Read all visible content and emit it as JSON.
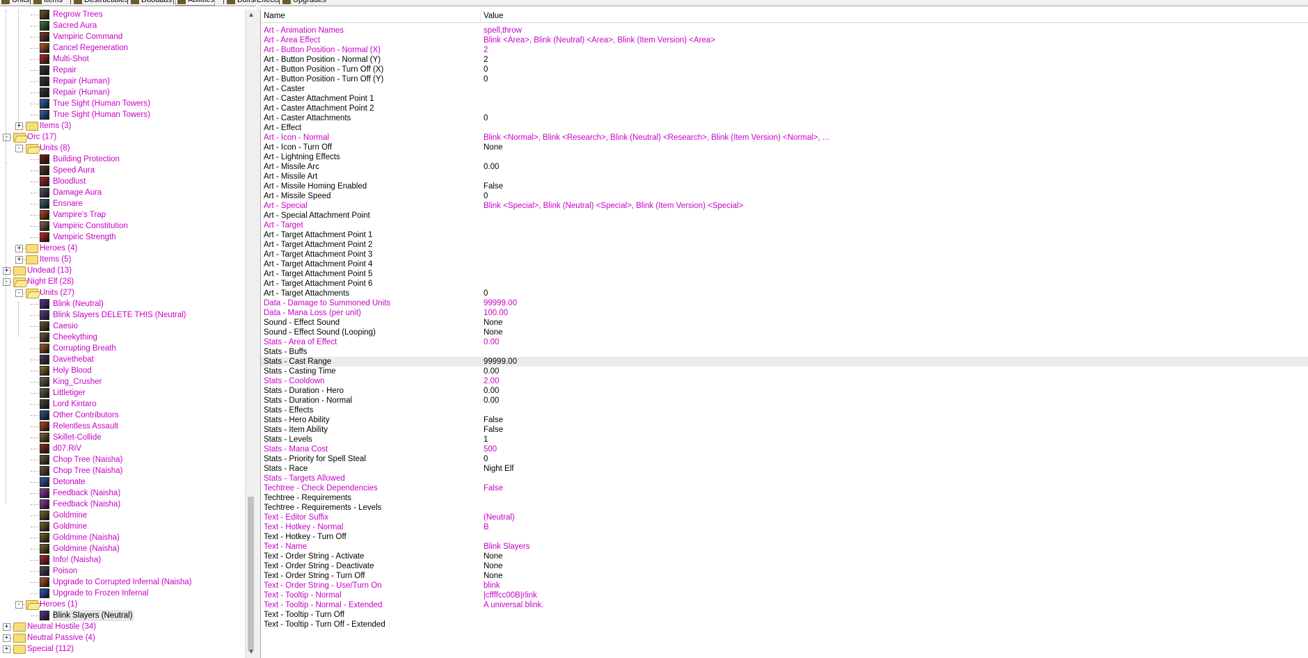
{
  "tabs": [
    {
      "label": "Units",
      "icon": "unit-icon"
    },
    {
      "label": "Items",
      "icon": "item-icon"
    },
    {
      "label": "Destructibles",
      "icon": "destructible-icon"
    },
    {
      "label": "Doodads",
      "icon": "doodad-icon"
    },
    {
      "label": "Abilities",
      "icon": "ability-icon",
      "active": true
    },
    {
      "label": "Buffs/Effects",
      "icon": "buff-icon"
    },
    {
      "label": "Upgrades",
      "icon": "upgrade-icon"
    }
  ],
  "tree": [
    {
      "label": "Regrow Trees",
      "level": 3,
      "kind": "ability",
      "color": "#7a5a2a"
    },
    {
      "label": "Sacred Aura",
      "level": 3,
      "kind": "ability",
      "color": "#4a7a3a"
    },
    {
      "label": "Vampiric Command",
      "level": 3,
      "kind": "ability",
      "color": "#8a3a2a"
    },
    {
      "label": "Cancel Regeneration",
      "level": 3,
      "kind": "ability",
      "color": "#c85a20"
    },
    {
      "label": "Multi-Shot",
      "level": 3,
      "kind": "ability",
      "color": "#c02a2a"
    },
    {
      "label": "Repair",
      "level": 3,
      "kind": "ability",
      "color": "#3a3a3a"
    },
    {
      "label": "Repair (Human)",
      "level": 3,
      "kind": "ability",
      "color": "#3a3a3a"
    },
    {
      "label": "Repair (Human)",
      "level": 3,
      "kind": "ability",
      "color": "#3a3a3a"
    },
    {
      "label": "True Sight (Human Towers)",
      "level": 3,
      "kind": "ability",
      "color": "#2a6ac0"
    },
    {
      "label": "True Sight (Human Towers)",
      "level": 3,
      "kind": "ability",
      "color": "#2a6ac0"
    },
    {
      "label": "Items (3)",
      "level": 2,
      "kind": "folder",
      "exp": "+"
    },
    {
      "label": "Orc (17)",
      "level": 1,
      "kind": "folder",
      "exp": "-",
      "open": true
    },
    {
      "label": "Units (8)",
      "level": 2,
      "kind": "folder",
      "exp": "-",
      "open": true
    },
    {
      "label": "Building Protection",
      "level": 3,
      "kind": "ability",
      "color": "#8a1a1a"
    },
    {
      "label": "Speed Aura",
      "level": 3,
      "kind": "ability",
      "color": "#5a3a2a"
    },
    {
      "label": "Bloodlust",
      "level": 3,
      "kind": "ability",
      "color": "#b02a1a"
    },
    {
      "label": "Damage Aura",
      "level": 3,
      "kind": "ability",
      "color": "#5a5a6a"
    },
    {
      "label": "Ensnare",
      "level": 3,
      "kind": "ability",
      "color": "#3a6a7a"
    },
    {
      "label": "Vampire's Trap",
      "level": 3,
      "kind": "ability",
      "color": "#c84a1a"
    },
    {
      "label": "Vampiric Constitution",
      "level": 3,
      "kind": "ability",
      "color": "#8a6a4a"
    },
    {
      "label": "Vampiric Strength",
      "level": 3,
      "kind": "ability",
      "color": "#d02a1a"
    },
    {
      "label": "Heroes (4)",
      "level": 2,
      "kind": "folder",
      "exp": "+"
    },
    {
      "label": "Items (5)",
      "level": 2,
      "kind": "folder",
      "exp": "+"
    },
    {
      "label": "Undead (13)",
      "level": 1,
      "kind": "folder",
      "exp": "+"
    },
    {
      "label": "Night Elf (28)",
      "level": 1,
      "kind": "folder",
      "exp": "-",
      "open": true
    },
    {
      "label": "Units (27)",
      "level": 2,
      "kind": "folder",
      "exp": "-",
      "open": true
    },
    {
      "label": "Blink (Neutral)",
      "level": 3,
      "kind": "ability",
      "color": "#5a3aa0"
    },
    {
      "label": "Blink Slayers DELETE THIS (Neutral)",
      "level": 3,
      "kind": "ability",
      "color": "#5a3aa0"
    },
    {
      "label": "Caesio",
      "level": 3,
      "kind": "ability",
      "color": "#6a5a2a"
    },
    {
      "label": "Cheekything",
      "level": 3,
      "kind": "ability",
      "color": "#7a5a3a"
    },
    {
      "label": "Corrupting Breath",
      "level": 3,
      "kind": "ability",
      "color": "#b05a2a"
    },
    {
      "label": "Davethebat",
      "level": 3,
      "kind": "ability",
      "color": "#4a3a6a"
    },
    {
      "label": "Holy Blood",
      "level": 3,
      "kind": "ability",
      "color": "#8a7a2a"
    },
    {
      "label": "King_Crusher",
      "level": 3,
      "kind": "ability",
      "color": "#6a6a5a"
    },
    {
      "label": "Littletiger",
      "level": 3,
      "kind": "ability",
      "color": "#5a6a4a"
    },
    {
      "label": "Lord Kintaro",
      "level": 3,
      "kind": "ability",
      "color": "#4a4a3a"
    },
    {
      "label": "Other Contributors",
      "level": 3,
      "kind": "ability",
      "color": "#2a5a8a"
    },
    {
      "label": "Relentless Assault",
      "level": 3,
      "kind": "ability",
      "color": "#c04a1a"
    },
    {
      "label": "Skillet-Collide",
      "level": 3,
      "kind": "ability",
      "color": "#8a6a2a"
    },
    {
      "label": "d07.RiV",
      "level": 3,
      "kind": "ability",
      "color": "#9a2a1a"
    },
    {
      "label": "Chop Tree (Naisha)",
      "level": 3,
      "kind": "ability",
      "color": "#6a5a3a"
    },
    {
      "label": "Chop Tree (Naisha)",
      "level": 3,
      "kind": "ability",
      "color": "#6a5a3a"
    },
    {
      "label": "Detonate",
      "level": 3,
      "kind": "ability",
      "color": "#3a5ac0"
    },
    {
      "label": "Feedback (Naisha)",
      "level": 3,
      "kind": "ability",
      "color": "#a03ab0"
    },
    {
      "label": "Feedback (Naisha)",
      "level": 3,
      "kind": "ability",
      "color": "#a03ab0"
    },
    {
      "label": "Goldmine",
      "level": 3,
      "kind": "ability",
      "color": "#7a6a2a"
    },
    {
      "label": "Goldmine",
      "level": 3,
      "kind": "ability",
      "color": "#7a6a2a"
    },
    {
      "label": "Goldmine (Naisha)",
      "level": 3,
      "kind": "ability",
      "color": "#7a6a2a"
    },
    {
      "label": "Goldmine (Naisha)",
      "level": 3,
      "kind": "ability",
      "color": "#7a6a2a"
    },
    {
      "label": "Info! (Naisha)",
      "level": 3,
      "kind": "ability",
      "color": "#c02a2a"
    },
    {
      "label": "Poison",
      "level": 3,
      "kind": "ability",
      "color": "#5a4a5a"
    },
    {
      "label": "Upgrade to Corrupted Infernal (Naisha)",
      "level": 3,
      "kind": "ability",
      "color": "#c05a1a"
    },
    {
      "label": "Upgrade to Frozen Infernal",
      "level": 3,
      "kind": "ability",
      "color": "#2a5ad0"
    },
    {
      "label": "Heroes (1)",
      "level": 2,
      "kind": "folder",
      "exp": "-",
      "open": true
    },
    {
      "label": "Blink Slayers (Neutral)",
      "level": 3,
      "kind": "ability",
      "color": "#5a3aa0",
      "selected": true
    },
    {
      "label": "Neutral Hostile (34)",
      "level": 1,
      "kind": "folder",
      "exp": "+"
    },
    {
      "label": "Neutral Passive (4)",
      "level": 1,
      "kind": "folder",
      "exp": "+"
    },
    {
      "label": "Special (112)",
      "level": 1,
      "kind": "folder",
      "exp": "+"
    }
  ],
  "grid": {
    "header": {
      "name": "Name",
      "value": "Value"
    },
    "rows": [
      {
        "name": "Art - Animation Names",
        "value": "spell,throw",
        "mod": true
      },
      {
        "name": "Art - Area Effect",
        "value": "Blink <Area>, Blink (Neutral) <Area>, Blink (Item Version) <Area>",
        "mod": true
      },
      {
        "name": "Art - Button Position - Normal (X)",
        "value": "2",
        "mod": true
      },
      {
        "name": "Art - Button Position - Normal (Y)",
        "value": "2"
      },
      {
        "name": "Art - Button Position - Turn Off (X)",
        "value": "0"
      },
      {
        "name": "Art - Button Position - Turn Off (Y)",
        "value": "0"
      },
      {
        "name": "Art - Caster",
        "value": ""
      },
      {
        "name": "Art - Caster Attachment Point 1",
        "value": ""
      },
      {
        "name": "Art - Caster Attachment Point 2",
        "value": ""
      },
      {
        "name": "Art - Caster Attachments",
        "value": "0"
      },
      {
        "name": "Art - Effect",
        "value": ""
      },
      {
        "name": "Art - Icon - Normal",
        "value": "Blink <Normal>, Blink <Research>, Blink (Neutral) <Research>, Blink (Item Version) <Normal>, ...",
        "mod": true
      },
      {
        "name": "Art - Icon - Turn Off",
        "value": "None"
      },
      {
        "name": "Art - Lightning Effects",
        "value": ""
      },
      {
        "name": "Art - Missile Arc",
        "value": "0.00"
      },
      {
        "name": "Art - Missile Art",
        "value": ""
      },
      {
        "name": "Art - Missile Homing Enabled",
        "value": "False"
      },
      {
        "name": "Art - Missile Speed",
        "value": "0"
      },
      {
        "name": "Art - Special",
        "value": "Blink <Special>, Blink (Neutral) <Special>, Blink (Item Version) <Special>",
        "mod": true
      },
      {
        "name": "Art - Special Attachment Point",
        "value": ""
      },
      {
        "name": "Art - Target",
        "value": "",
        "mod": true
      },
      {
        "name": "Art - Target Attachment Point 1",
        "value": ""
      },
      {
        "name": "Art - Target Attachment Point 2",
        "value": ""
      },
      {
        "name": "Art - Target Attachment Point 3",
        "value": ""
      },
      {
        "name": "Art - Target Attachment Point 4",
        "value": ""
      },
      {
        "name": "Art - Target Attachment Point 5",
        "value": ""
      },
      {
        "name": "Art - Target Attachment Point 6",
        "value": ""
      },
      {
        "name": "Art - Target Attachments",
        "value": "0"
      },
      {
        "name": "Data - Damage to Summoned Units",
        "value": "99999.00",
        "mod": true
      },
      {
        "name": "Data - Mana Loss (per unit)",
        "value": "100.00",
        "mod": true
      },
      {
        "name": "Sound - Effect Sound",
        "value": "None"
      },
      {
        "name": "Sound - Effect Sound (Looping)",
        "value": "None"
      },
      {
        "name": "Stats - Area of Effect",
        "value": "0.00",
        "mod": true
      },
      {
        "name": "Stats - Buffs",
        "value": ""
      },
      {
        "name": "Stats - Cast Range",
        "value": "99999.00",
        "highlight": true
      },
      {
        "name": "Stats - Casting Time",
        "value": "0.00"
      },
      {
        "name": "Stats - Cooldown",
        "value": "2.00",
        "mod": true
      },
      {
        "name": "Stats - Duration - Hero",
        "value": "0.00"
      },
      {
        "name": "Stats - Duration - Normal",
        "value": "0.00"
      },
      {
        "name": "Stats - Effects",
        "value": ""
      },
      {
        "name": "Stats - Hero Ability",
        "value": "False"
      },
      {
        "name": "Stats - Item Ability",
        "value": "False"
      },
      {
        "name": "Stats - Levels",
        "value": "1"
      },
      {
        "name": "Stats - Mana Cost",
        "value": "500",
        "mod": true
      },
      {
        "name": "Stats - Priority for Spell Steal",
        "value": "0"
      },
      {
        "name": "Stats - Race",
        "value": "Night Elf"
      },
      {
        "name": "Stats - Targets Allowed",
        "value": "",
        "mod": true
      },
      {
        "name": "Techtree - Check Dependencies",
        "value": "False",
        "mod": true
      },
      {
        "name": "Techtree - Requirements",
        "value": ""
      },
      {
        "name": "Techtree - Requirements - Levels",
        "value": ""
      },
      {
        "name": "Text - Editor Suffix",
        "value": "(Neutral)",
        "mod": true
      },
      {
        "name": "Text - Hotkey - Normal",
        "value": "B",
        "mod": true
      },
      {
        "name": "Text - Hotkey - Turn Off",
        "value": ""
      },
      {
        "name": "Text - Name",
        "value": "Blink Slayers",
        "mod": true
      },
      {
        "name": "Text - Order String - Activate",
        "value": "None"
      },
      {
        "name": "Text - Order String - Deactivate",
        "value": "None"
      },
      {
        "name": "Text - Order String - Turn Off",
        "value": "None"
      },
      {
        "name": "Text - Order String - Use/Turn On",
        "value": "blink",
        "mod": true
      },
      {
        "name": "Text - Tooltip - Normal",
        "value": "|cffffcc00B|rlink",
        "mod": true
      },
      {
        "name": "Text - Tooltip - Normal - Extended",
        "value": "A universal blink.",
        "mod": true
      },
      {
        "name": "Text - Tooltip - Turn Off",
        "value": ""
      },
      {
        "name": "Text - Tooltip - Turn Off - Extended",
        "value": ""
      }
    ]
  },
  "scrollbar": {
    "up": "▲",
    "down": "▼"
  }
}
